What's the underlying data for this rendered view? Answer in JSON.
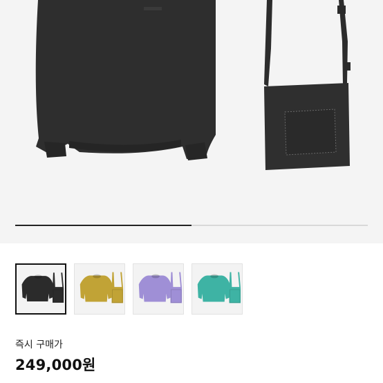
{
  "gallery": {
    "progress_fraction": 0.5,
    "selected_index": 0,
    "thumbnails": [
      {
        "name": "black",
        "color": "#2b2b2b"
      },
      {
        "name": "mustard",
        "color": "#c1a336"
      },
      {
        "name": "lavender",
        "color": "#9f8fd6"
      },
      {
        "name": "teal",
        "color": "#3eb3a4"
      }
    ]
  },
  "purchase": {
    "label": "즉시 구매가",
    "price": "249,000원"
  }
}
